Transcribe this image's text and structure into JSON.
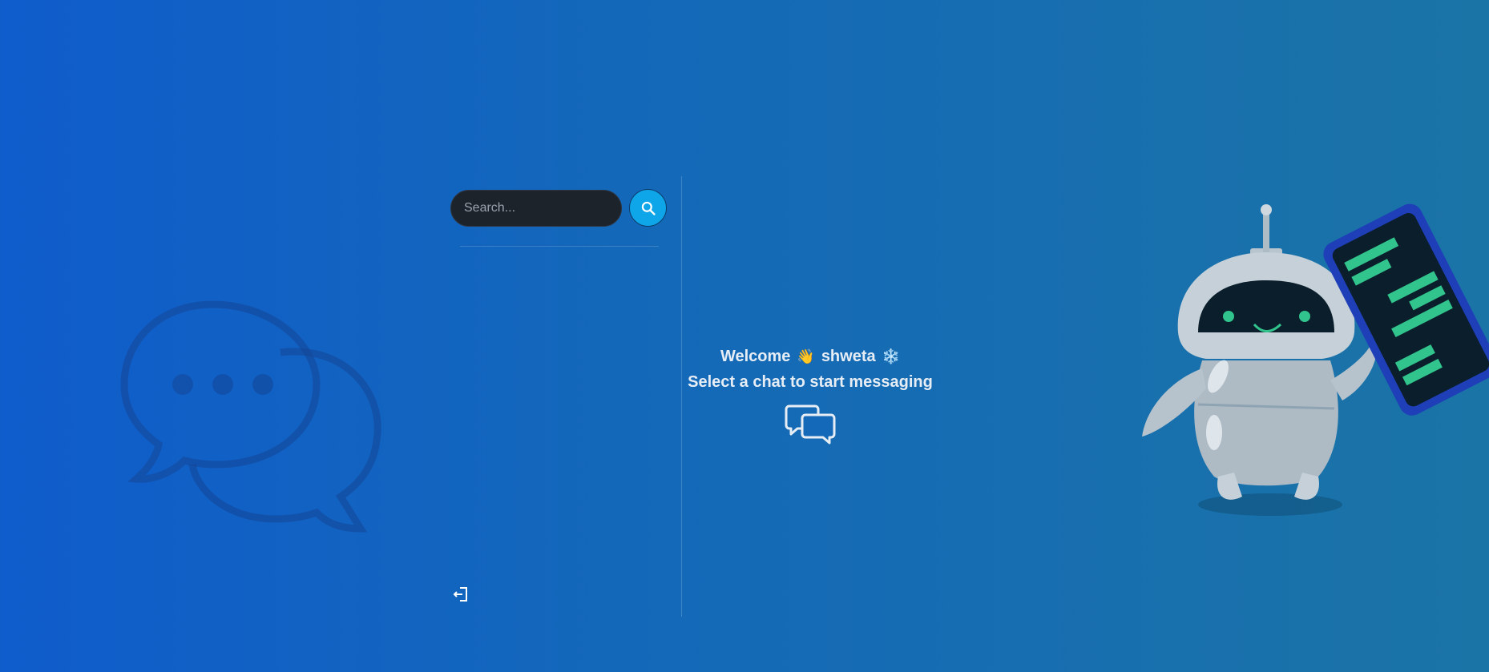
{
  "sidebar": {
    "search": {
      "placeholder": "Search...",
      "value": ""
    },
    "icons": {
      "search_button": "search-icon",
      "logout": "logout-icon"
    }
  },
  "main": {
    "welcome_text": "Welcome",
    "wave_emoji": "👋",
    "username": "shweta",
    "snowflake_emoji": "❄️",
    "subtitle": "Select a chat to start messaging",
    "icon": "chat-bubbles-icon"
  },
  "colors": {
    "search_button": "#0ea5e9",
    "search_input_bg": "#1d232a"
  }
}
